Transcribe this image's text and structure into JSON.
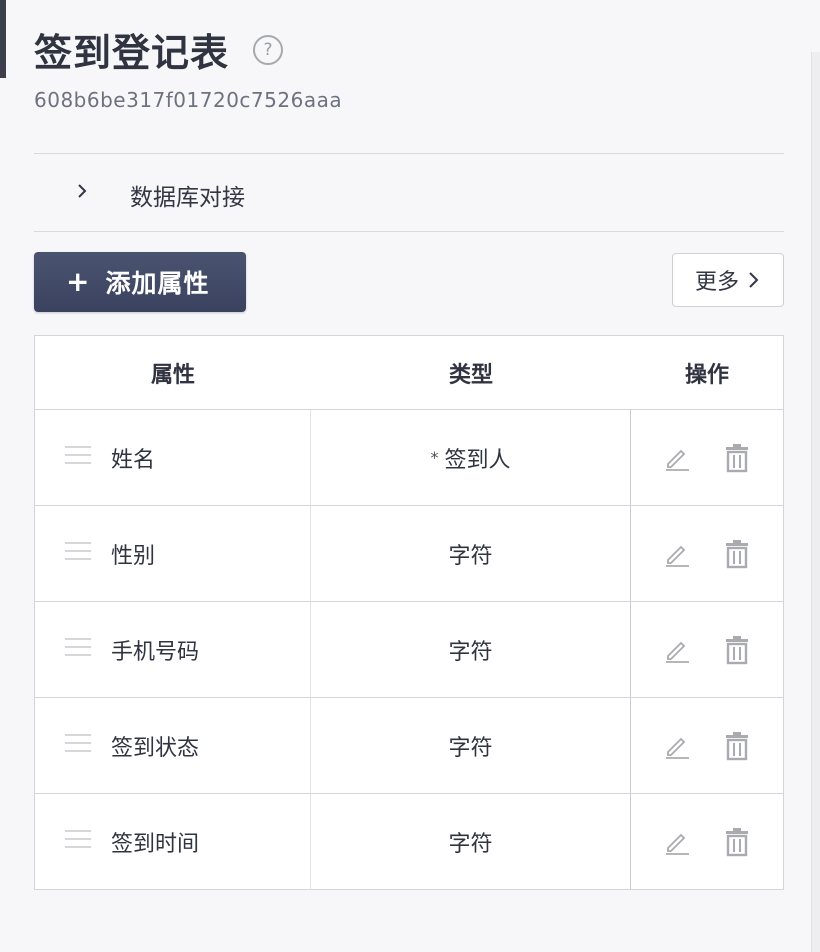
{
  "header": {
    "title": "签到登记表",
    "form_id": "608b6be317f01720c7526aaa",
    "help_glyph": "?"
  },
  "database": {
    "label": "数据库对接",
    "icon": "chevron-right-icon"
  },
  "toolbar": {
    "add_plus": "+",
    "add_label": "添加属性",
    "more_label": "更多",
    "more_chevron": "›"
  },
  "colors": {
    "primary_button": "#3e4664",
    "border": "#d4d5da",
    "icon_gray": "#a9abb1"
  },
  "table": {
    "headers": {
      "attribute": "属性",
      "type": "类型",
      "actions": "操作"
    },
    "rows": [
      {
        "name": "姓名",
        "type_prefix": "*",
        "type": "签到人"
      },
      {
        "name": "性别",
        "type_prefix": "",
        "type": "字符"
      },
      {
        "name": "手机号码",
        "type_prefix": "",
        "type": "字符"
      },
      {
        "name": "签到状态",
        "type_prefix": "",
        "type": "字符"
      },
      {
        "name": "签到时间",
        "type_prefix": "",
        "type": "字符"
      }
    ]
  }
}
